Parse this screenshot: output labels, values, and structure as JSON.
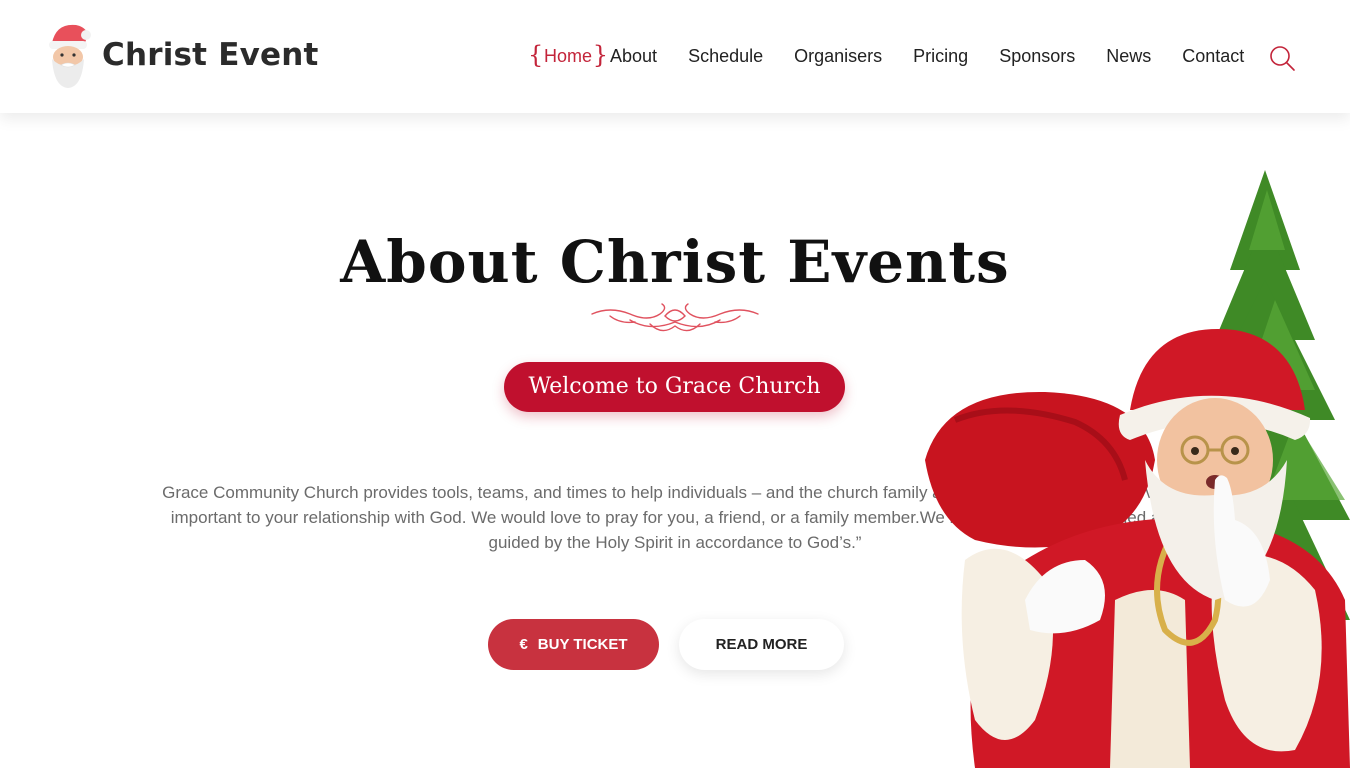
{
  "header": {
    "logo_text": "Christ Event",
    "nav": [
      {
        "label": "Home",
        "active": true
      },
      {
        "label": "About"
      },
      {
        "label": "Schedule"
      },
      {
        "label": "Organisers"
      },
      {
        "label": "Pricing"
      },
      {
        "label": "Sponsors"
      },
      {
        "label": "News"
      },
      {
        "label": "Contact"
      }
    ],
    "search_icon": "search-icon"
  },
  "hero": {
    "title": "About Christ Events",
    "welcome_button": "Welcome to Grace Church",
    "description": "Grace Community Church provides tools, teams, and times to help individuals – and the church family as a whole – pray. Prayer is vitally important to your relationship with God. We would love to pray for you, a friend, or a family member.We believe that actions fueled and guided by the Holy Spirit in accordance to God’s.”",
    "buy_ticket": {
      "icon": "€",
      "label": "BUY TICKET"
    },
    "read_more": "READ MORE"
  },
  "colors": {
    "accent": "#c3243a",
    "welcome_bg": "#c0102e",
    "buy_bg": "#c8323f"
  }
}
